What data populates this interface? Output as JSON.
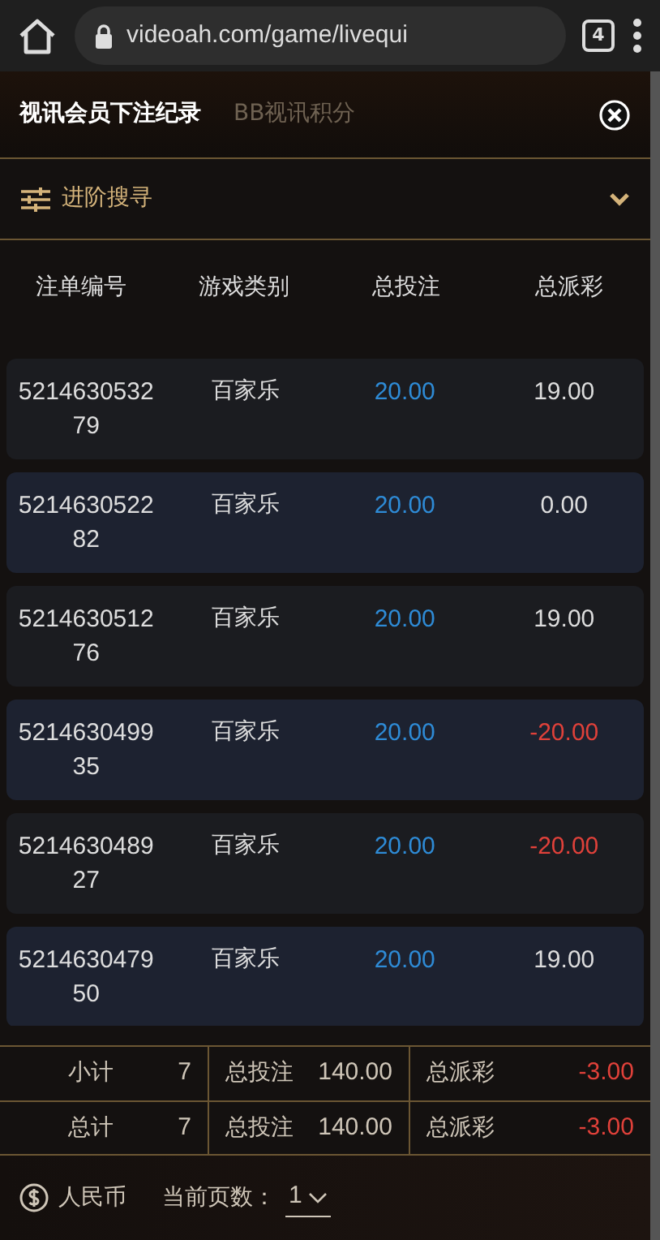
{
  "browser": {
    "url": "videoah.com/game/livequi",
    "tab_count": "4"
  },
  "tabs": [
    {
      "label": "视讯会员下注纪录",
      "selected": true
    },
    {
      "label": "BB视讯积分",
      "selected": false
    }
  ],
  "advanced_search": {
    "label": "进阶搜寻",
    "expanded": false
  },
  "table": {
    "columns": [
      "注单编号",
      "游戏类别",
      "总投注",
      "总派彩"
    ],
    "rows": [
      {
        "id": "521463053279",
        "game": "百家乐",
        "bet": "20.00",
        "payout": "19.00",
        "negative": false
      },
      {
        "id": "521463052282",
        "game": "百家乐",
        "bet": "20.00",
        "payout": "0.00",
        "negative": false
      },
      {
        "id": "521463051276",
        "game": "百家乐",
        "bet": "20.00",
        "payout": "19.00",
        "negative": false
      },
      {
        "id": "521463049935",
        "game": "百家乐",
        "bet": "20.00",
        "payout": "-20.00",
        "negative": true
      },
      {
        "id": "521463048927",
        "game": "百家乐",
        "bet": "20.00",
        "payout": "-20.00",
        "negative": true
      },
      {
        "id": "521463047950",
        "game": "百家乐",
        "bet": "20.00",
        "payout": "19.00",
        "negative": false
      }
    ]
  },
  "summary": [
    {
      "label": "小计",
      "count": "7",
      "bet_label": "总投注",
      "bet": "140.00",
      "payout_label": "总派彩",
      "payout": "-3.00",
      "negative": true
    },
    {
      "label": "总计",
      "count": "7",
      "bet_label": "总投注",
      "bet": "140.00",
      "payout_label": "总派彩",
      "payout": "-3.00",
      "negative": true
    }
  ],
  "footer": {
    "currency": "人民币",
    "page_label": "当前页数：",
    "page": "1"
  }
}
